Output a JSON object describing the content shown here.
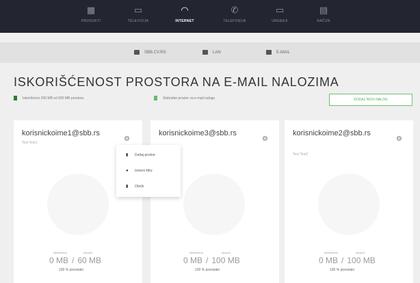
{
  "topnav": {
    "items": [
      {
        "label": "PRODUKTI",
        "icon": "tv-icon",
        "glyph": "▦",
        "active": false
      },
      {
        "label": "TELEVIZIJA",
        "icon": "monitor-icon",
        "glyph": "▭",
        "active": false
      },
      {
        "label": "INTERNET",
        "icon": "wifi-icon",
        "glyph": "◠",
        "active": true
      },
      {
        "label": "TELEFONIJA",
        "icon": "phone-icon",
        "glyph": "✆",
        "active": false
      },
      {
        "label": "UREĐAJI",
        "icon": "devices-icon",
        "glyph": "▭",
        "active": false
      },
      {
        "label": "RAČUN",
        "icon": "bill-icon",
        "glyph": "▤",
        "active": false
      }
    ]
  },
  "subnav": {
    "items": [
      {
        "label": "SBB.CV.RS",
        "icon": "server-icon"
      },
      {
        "label": "LAN",
        "icon": "lan-icon"
      },
      {
        "label": "E-MAIL",
        "icon": "mail-icon"
      }
    ]
  },
  "page": {
    "title": "ISKORIŠĆENOST PROSTORA NA E-MAIL NALOZIMA",
    "legend_used": "Iskorišćeno 260 MB od 600 MB prostora",
    "legend_free": "Slobodan prostor za e-mail naloge",
    "add_button": "DODAJ NOVI NALOG"
  },
  "accounts": [
    {
      "email": "korisnickoime1@sbb.rs",
      "name": "Test Test1",
      "used_label": "iskorišćeno",
      "total_label": "ukupno",
      "used": "0 MB",
      "total": "60 MB",
      "percent": "100 % preostalo"
    },
    {
      "email": "korisnickoime3@sbb.rs",
      "name": "",
      "used_label": "iskorišćeno",
      "total_label": "ukupno",
      "used": "0 MB",
      "total": "100 MB",
      "percent": "100 % preostalo"
    },
    {
      "email": "korisnickoime2@sbb.rs",
      "name": "Test Test2",
      "used_label": "iskorišćeno",
      "total_label": "ukupno",
      "used": "0 MB",
      "total": "100 MB",
      "percent": "100 % preostalo"
    }
  ],
  "dropdown": {
    "items": [
      {
        "label": "Dodaj prostor",
        "icon": "storage-icon"
      },
      {
        "label": "Izmeni šifru",
        "icon": "lock-icon"
      },
      {
        "label": "Obriši",
        "icon": "trash-icon"
      }
    ]
  },
  "colors": {
    "nav_bg": "#232631",
    "accent_green": "#4caf50",
    "legend_used": "#2e7d32",
    "legend_free": "#66bb6a"
  }
}
